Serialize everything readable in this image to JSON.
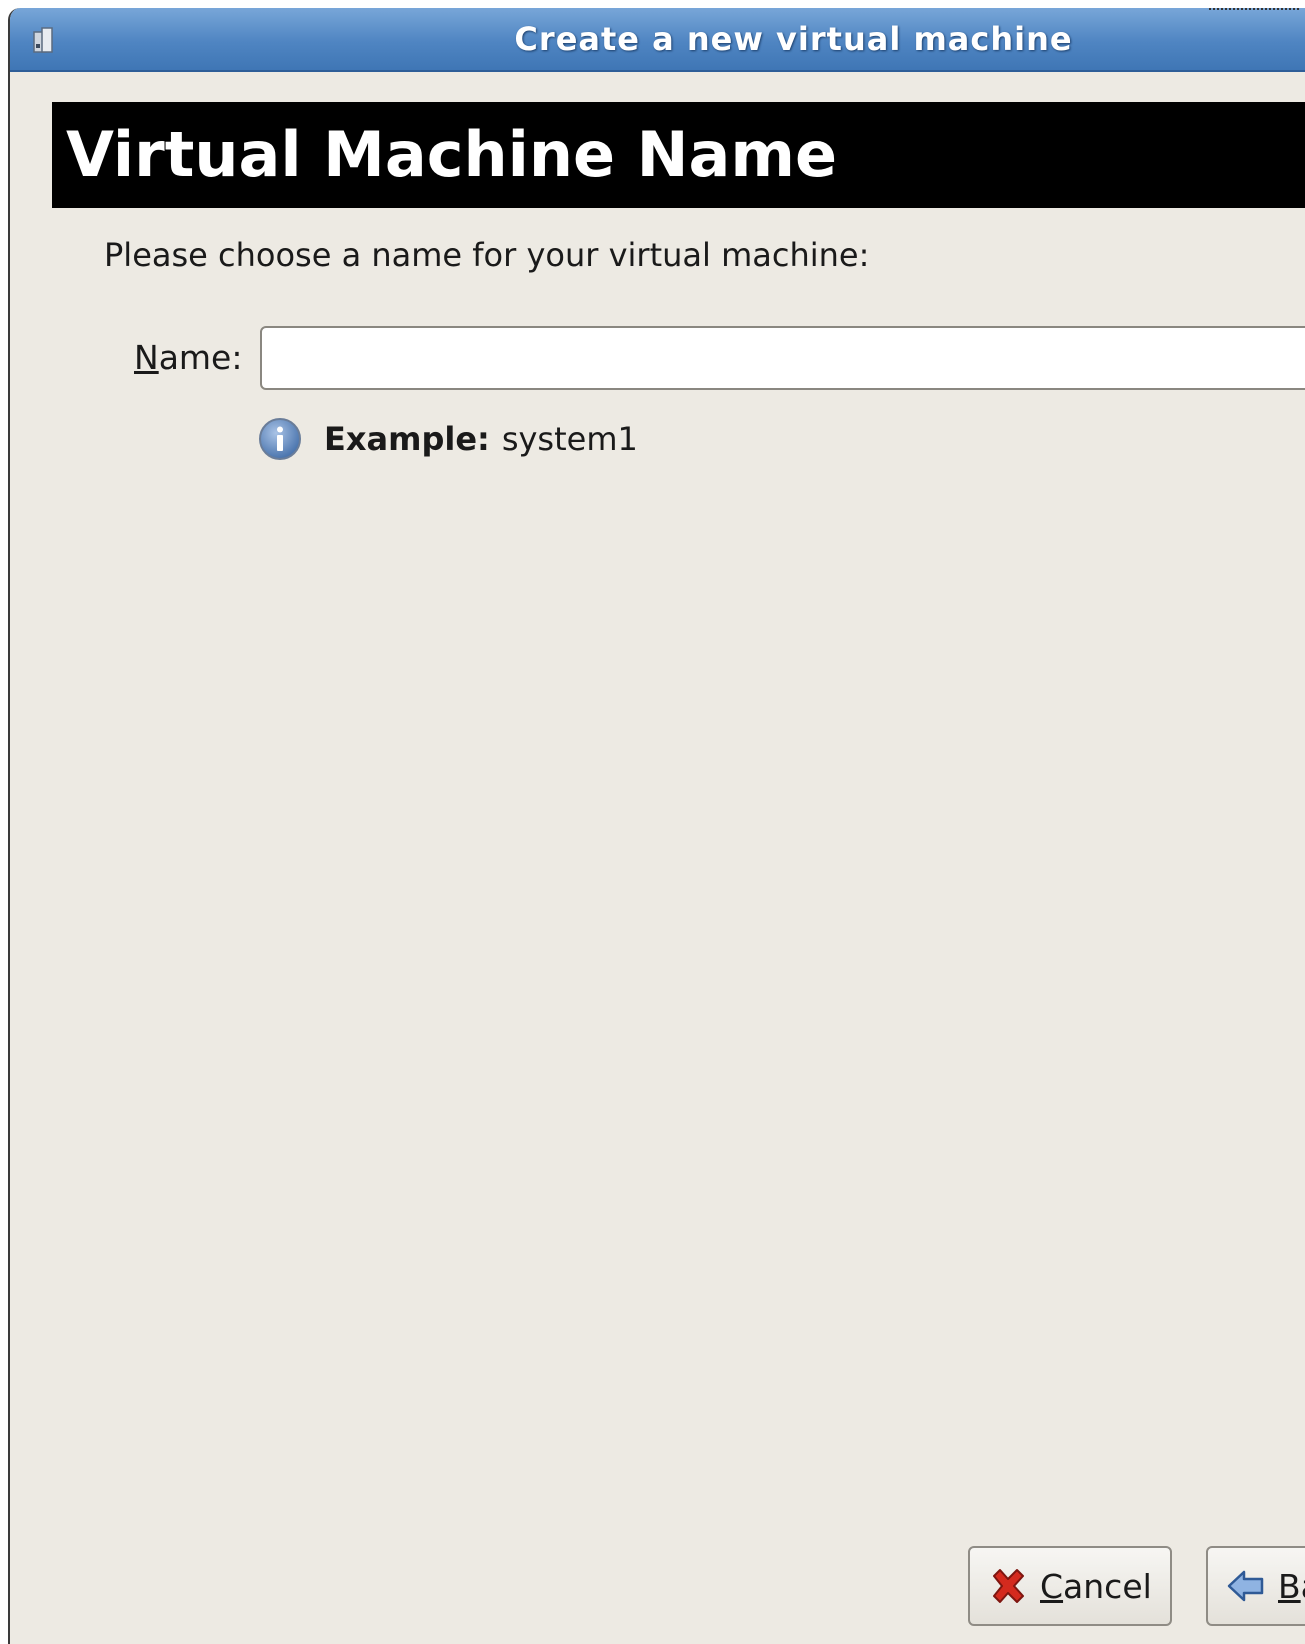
{
  "window": {
    "title": "Create a new virtual machine"
  },
  "header": {
    "title": "Virtual Machine Name"
  },
  "form": {
    "prompt": "Please choose a name for your virtual machine:",
    "name_label_mnemonic": "N",
    "name_label_rest": "ame:",
    "name_value": "",
    "example_label": "Example:",
    "example_value": "system1"
  },
  "buttons": {
    "cancel_mnemonic": "C",
    "cancel_rest": "ancel",
    "back_mnemonic": "B",
    "back_rest": "ack"
  },
  "icons": {
    "titlebar": "app-icon",
    "info": "info-icon",
    "cancel": "red-x-icon",
    "back": "left-arrow-icon"
  },
  "colors": {
    "titlebar": "#4f85c2",
    "header_band": "#000000",
    "window_bg": "#edeae3",
    "cancel_icon": "#d42a1e",
    "back_icon": "#3c6fb5"
  }
}
